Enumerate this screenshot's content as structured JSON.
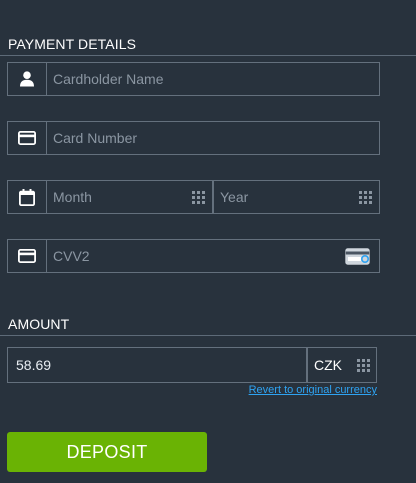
{
  "payment_details": {
    "title": "PAYMENT DETAILS",
    "cardholder_placeholder": "Cardholder Name",
    "card_number_placeholder": "Card Number",
    "month_placeholder": "Month",
    "year_placeholder": "Year",
    "cvv_placeholder": "CVV2"
  },
  "amount": {
    "title": "AMOUNT",
    "value": "58.69",
    "currency": "CZK",
    "revert_link": "Revert to original currency"
  },
  "deposit_button_label": "DEPOSIT",
  "icons": {
    "cardholder": "user-icon",
    "card_number": "credit-card-icon",
    "expiry": "calendar-icon",
    "cvv": "credit-card-icon",
    "cvv_hint": "card-cvv-icon",
    "dropdown": "grid-icon"
  },
  "colors": {
    "background": "#28323d",
    "border": "#64707d",
    "placeholder": "#8b96a2",
    "link": "#2ea3f2",
    "deposit_button": "#6ab304"
  }
}
